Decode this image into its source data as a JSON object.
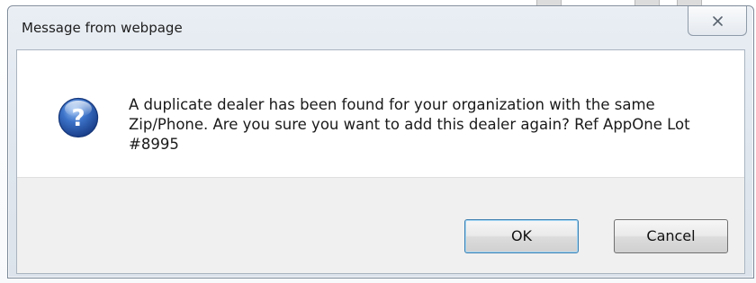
{
  "dialog": {
    "title": "Message from webpage",
    "close_label": "Close",
    "icon": "question-icon",
    "message": "A duplicate dealer has been found for your organization with the same Zip/Phone. Are you sure you want to add this dealer again? Ref AppOne Lot #8995",
    "buttons": {
      "ok_label": "OK",
      "cancel_label": "Cancel"
    }
  },
  "colors": {
    "frame": "#dfe6ee",
    "icon_blue": "#2f5fb3",
    "button_area": "#f0f0f0",
    "default_button_border": "#3c7fb1"
  }
}
